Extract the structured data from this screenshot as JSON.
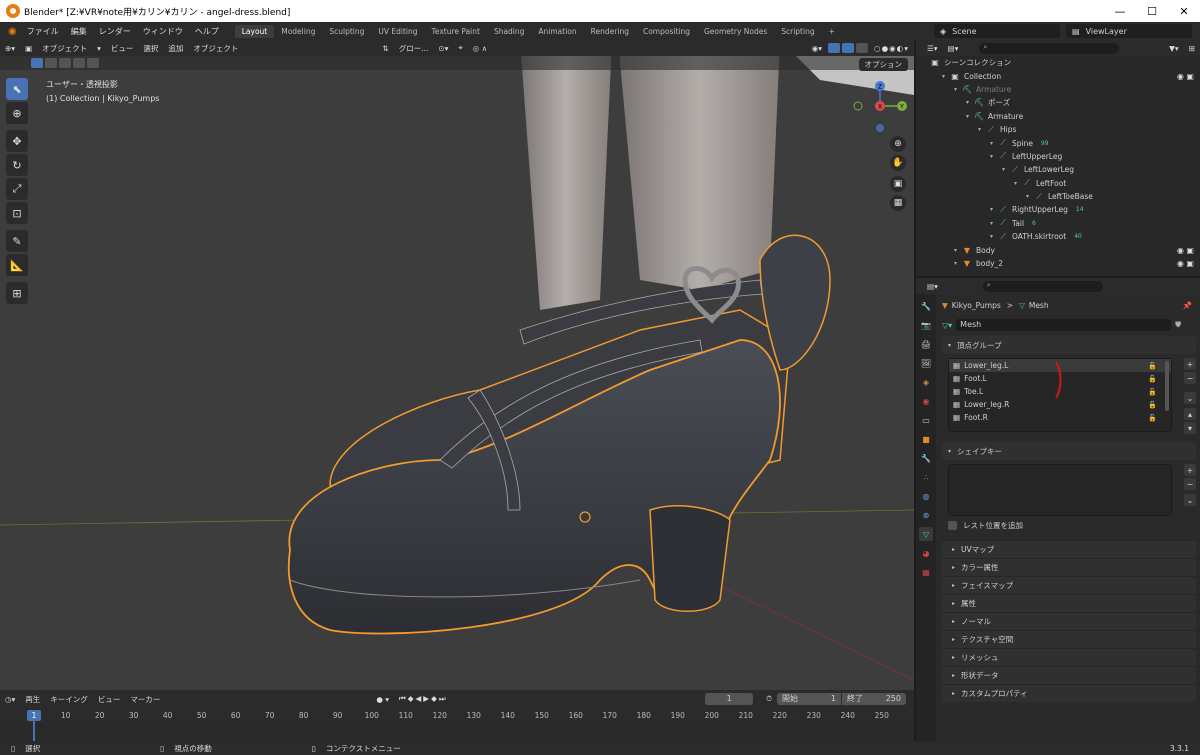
{
  "window": {
    "title": "Blender* [Z:¥VR¥note用¥カリン¥カリン - angel-dress.blend]",
    "minimize": "—",
    "maximize": "☐",
    "close": "✕"
  },
  "menu": [
    "ファイル",
    "編集",
    "レンダー",
    "ウィンドウ",
    "ヘルプ"
  ],
  "workspaces": [
    "Layout",
    "Modeling",
    "Sculpting",
    "UV Editing",
    "Texture Paint",
    "Shading",
    "Animation",
    "Rendering",
    "Compositing",
    "Geometry Nodes",
    "Scripting",
    "+"
  ],
  "scene": "Scene",
  "viewlayer": "ViewLayer",
  "viewport": {
    "mode": "オブジェクト",
    "menus": [
      "ビュー",
      "選択",
      "追加",
      "オブジェクト"
    ],
    "transform": "グロー...",
    "options": "オプション",
    "info_line1": "ユーザー・透視投影",
    "info_line2": "(1) Collection | Kikyo_Pumps"
  },
  "gizmo": {
    "z": "Z",
    "y": "Y",
    "x": "X"
  },
  "outliner": {
    "root": "シーンコレクション",
    "rows": [
      {
        "label": "Collection",
        "indent": 1,
        "icon": "collection"
      },
      {
        "label": "Armature",
        "indent": 2,
        "icon": "armature",
        "dim": true
      },
      {
        "label": "ポーズ",
        "indent": 3,
        "icon": "pose"
      },
      {
        "label": "Armature",
        "indent": 3,
        "icon": "armature"
      },
      {
        "label": "Hips",
        "indent": 4,
        "icon": "bone"
      },
      {
        "label": "Spine",
        "indent": 5,
        "icon": "bone",
        "extra": "99"
      },
      {
        "label": "LeftUpperLeg",
        "indent": 5,
        "icon": "bone"
      },
      {
        "label": "LeftLowerLeg",
        "indent": 6,
        "icon": "bone"
      },
      {
        "label": "LeftFoot",
        "indent": 7,
        "icon": "bone"
      },
      {
        "label": "LeftToeBase",
        "indent": 8,
        "icon": "bone"
      },
      {
        "label": "RightUpperLeg",
        "indent": 5,
        "icon": "bone",
        "extra": "14"
      },
      {
        "label": "Tail",
        "indent": 5,
        "icon": "bone",
        "extra": "6"
      },
      {
        "label": "OATH.skirtroot",
        "indent": 5,
        "icon": "bone",
        "extra": "40"
      },
      {
        "label": "Body",
        "indent": 2,
        "icon": "mesh"
      },
      {
        "label": "body_2",
        "indent": 2,
        "icon": "mesh"
      }
    ]
  },
  "properties": {
    "breadcrumb_obj": "Kikyo_Pumps",
    "breadcrumb_sep": ">",
    "breadcrumb_data": "Mesh",
    "mesh_name": "Mesh",
    "vertex_groups_title": "頂点グループ",
    "vertex_groups": [
      "Lower_leg.L",
      "Foot.L",
      "Toe.L",
      "Lower_leg.R",
      "Foot.R"
    ],
    "shape_keys_title": "シェイプキー",
    "add_rest_position": "レスト位置を追加",
    "collapsed_panels": [
      "UVマップ",
      "カラー属性",
      "フェイスマップ",
      "属性",
      "ノーマル",
      "テクスチャ空間",
      "リメッシュ",
      "形状データ",
      "カスタムプロパティ"
    ]
  },
  "timeline": {
    "menus": [
      "再生",
      "キーイング",
      "ビュー",
      "マーカー"
    ],
    "current_frame": "1",
    "start_label": "開始",
    "start": "1",
    "end_label": "終了",
    "end": "250",
    "ticks": [
      "1",
      "10",
      "20",
      "30",
      "40",
      "50",
      "60",
      "70",
      "80",
      "90",
      "100",
      "110",
      "120",
      "130",
      "140",
      "150",
      "160",
      "170",
      "180",
      "190",
      "200",
      "210",
      "220",
      "230",
      "240",
      "250"
    ]
  },
  "status": {
    "select": "選択",
    "move": "視点の移動",
    "context": "コンテクストメニュー",
    "version": "3.3.1"
  }
}
